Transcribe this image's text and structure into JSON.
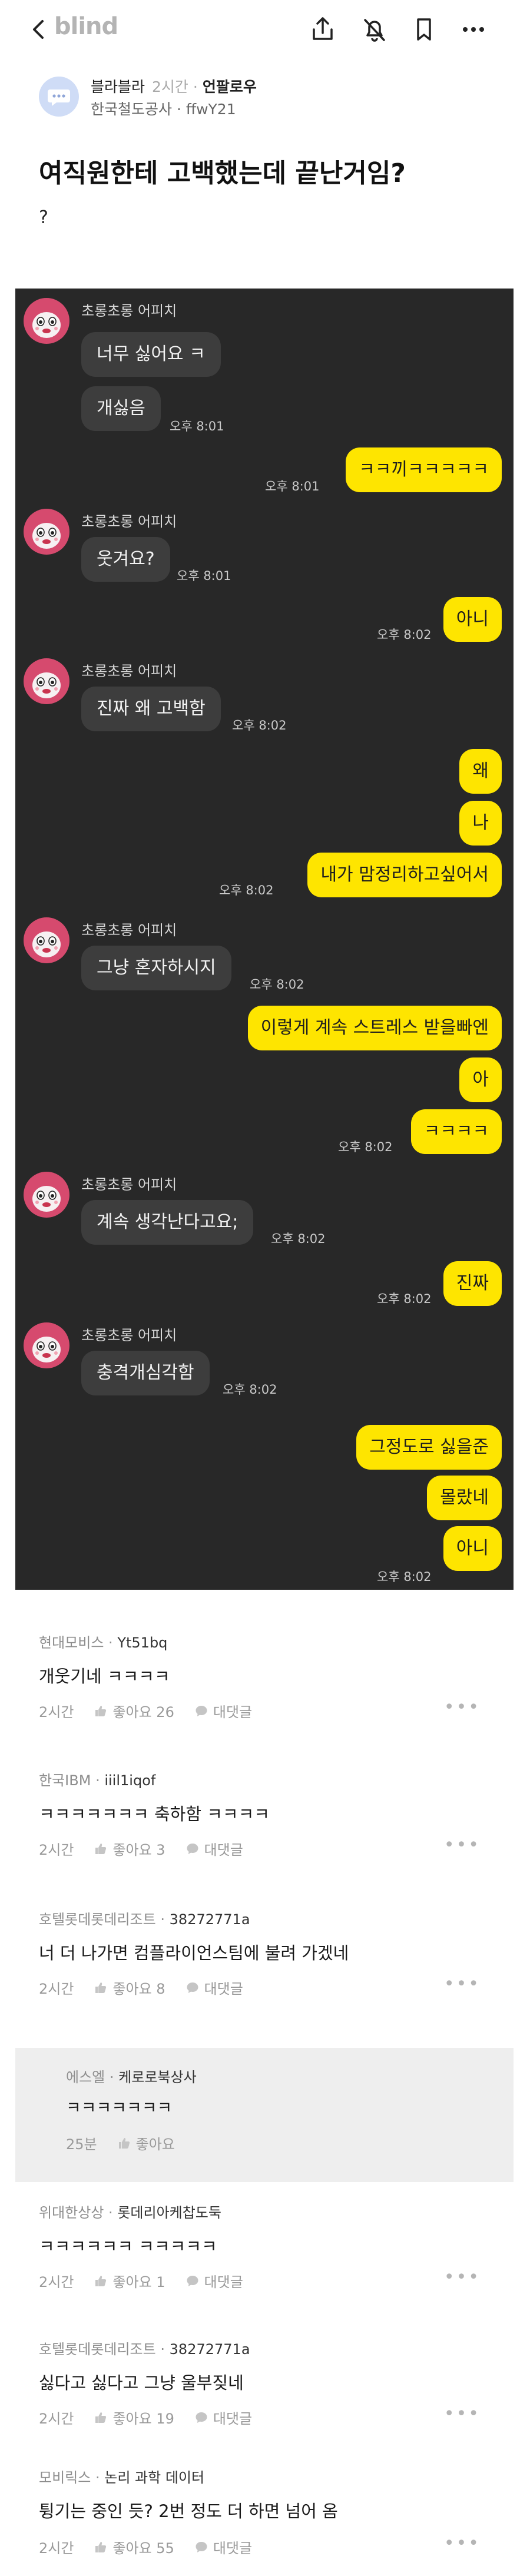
{
  "header": {
    "logo": "blind"
  },
  "author": {
    "name": "블라블라",
    "time": "2시간",
    "dot": "·",
    "follow": "언팔로우",
    "company_line": "한국철도공사 · ffwY21"
  },
  "post": {
    "title": "여직원한테 고백했는데 끝난거임?",
    "body": "?"
  },
  "chat": {
    "sender_name": "초롱초롱 어피치",
    "colors": {
      "background": "#282828",
      "incoming": "#3d3d3d",
      "outgoing": "#fee500"
    },
    "messages": [
      {
        "dir": "in",
        "text": "너무 싫어요 ㅋ"
      },
      {
        "dir": "in",
        "text": "개싫음",
        "time": "오후 8:01"
      },
      {
        "dir": "out",
        "text": "ㅋㅋ끼ㅋㅋㅋㅋㅋ",
        "time": "오후 8:01"
      },
      {
        "dir": "in",
        "text": "웃겨요?",
        "time": "오후 8:01"
      },
      {
        "dir": "out",
        "text": "아니",
        "time": "오후 8:02"
      },
      {
        "dir": "in",
        "text": "진짜 왜 고백함",
        "time": "오후 8:02"
      },
      {
        "dir": "out",
        "text": "왜"
      },
      {
        "dir": "out",
        "text": "나"
      },
      {
        "dir": "out",
        "text": "내가 맘정리하고싶어서",
        "time": "오후 8:02"
      },
      {
        "dir": "in",
        "text": "그냥 혼자하시지",
        "time": "오후 8:02"
      },
      {
        "dir": "out",
        "text": "이렇게 계속 스트레스 받을빠엔"
      },
      {
        "dir": "out",
        "text": "아"
      },
      {
        "dir": "out",
        "text": "ㅋㅋㅋㅋ",
        "time": "오후 8:02"
      },
      {
        "dir": "in",
        "text": "계속 생각난다고요;",
        "time": "오후 8:02"
      },
      {
        "dir": "out",
        "text": "진짜",
        "time": "오후 8:02"
      },
      {
        "dir": "in",
        "text": "충격개심각함",
        "time": "오후 8:02"
      },
      {
        "dir": "out",
        "text": "그정도로 싫을준"
      },
      {
        "dir": "out",
        "text": "몰랐네"
      },
      {
        "dir": "out",
        "text": "아니",
        "time": "오후 8:02"
      }
    ]
  },
  "comments": [
    {
      "company": "현대모비스",
      "nick": "Yt51bq",
      "text": "개웃기네 ㅋㅋㅋㅋ",
      "time": "2시간",
      "likes_label": "좋아요 26",
      "reply_label": "대댓글"
    },
    {
      "company": "한국IBM",
      "nick": "iiil1iqof",
      "text": "ㅋㅋㅋㅋㅋㅋㅋ 축하함 ㅋㅋㅋㅋ",
      "time": "2시간",
      "likes_label": "좋아요 3",
      "reply_label": "대댓글"
    },
    {
      "company": "호텔롯데롯데리조트",
      "nick": "38272771a",
      "text": "너 더 나가면 컴플라이언스팀에 불려 가겠네",
      "time": "2시간",
      "likes_label": "좋아요 8",
      "reply_label": "대댓글"
    },
    {
      "company": "위대한상상",
      "nick": "롯데리아케찹도둑",
      "text": "ㅋㅋㅋㅋㅋㅋ ㅋㅋㅋㅋㅋ",
      "time": "2시간",
      "likes_label": "좋아요 1",
      "reply_label": "대댓글"
    },
    {
      "company": "호텔롯데롯데리조트",
      "nick": "38272771a",
      "text": "싫다고 싫다고 그냥 울부짖네",
      "time": "2시간",
      "likes_label": "좋아요 19",
      "reply_label": "대댓글"
    },
    {
      "company": "모비릭스",
      "nick": "논리 과학 데이터",
      "text": "튕기는 중인 듯? 2번 정도 더 하면 넘어 옴",
      "time": "2시간",
      "likes_label": "좋아요 55",
      "reply_label": "대댓글"
    }
  ],
  "reply": {
    "company": "에스엘",
    "nick": "케로로북상사",
    "text": "ㅋㅋㅋㅋㅋㅋㅋ",
    "time": "25분",
    "likes_label": "좋아요"
  },
  "more_glyph": "•••",
  "sep": "·"
}
